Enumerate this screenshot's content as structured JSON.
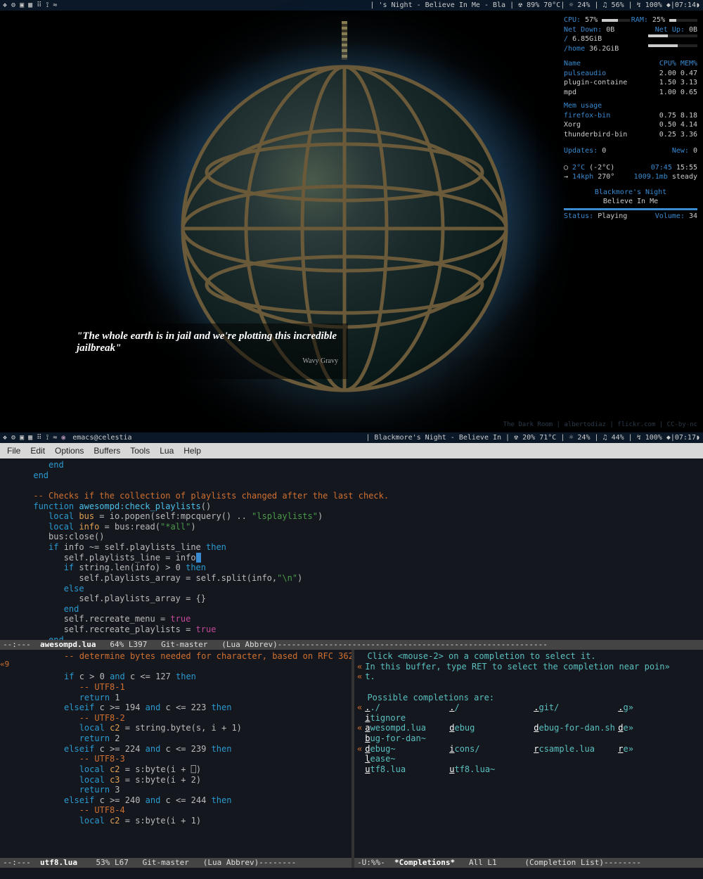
{
  "topbar1": {
    "left_icons": [
      "❖",
      "⚙",
      "▣",
      "▦",
      "⠿",
      "⟟",
      "≈"
    ],
    "right": "| 's Night - Believe In Me - Bla | ☢ 89% 70°C| ☼ 24% | ♫ 56% | ↯ 100% ◆|07:14◗"
  },
  "conky": {
    "cpu_l": "CPU:",
    "cpu_v": "57%",
    "ram_l": "RAM:",
    "ram_v": "25%",
    "ndl": "Net Down:",
    "ndv": "0B",
    "nul": "Net Up:",
    "nuv": "0B",
    "root": "/",
    "root_v": "6.85GiB",
    "home": "/home",
    "home_v": "36.2GiB",
    "hdr_name": "Name",
    "hdr_cpu": "CPU%",
    "hdr_mem": "MEM%",
    "p1": {
      "n": "pulseaudio",
      "c": "2.00",
      "m": "0.47"
    },
    "p2": {
      "n": "plugin-containe",
      "c": "1.50",
      "m": "3.13"
    },
    "p3": {
      "n": "mpd",
      "c": "1.00",
      "m": "0.65"
    },
    "mhdr": "Mem usage",
    "p4": {
      "n": "firefox-bin",
      "c": "0.75",
      "m": "8.18"
    },
    "p5": {
      "n": "Xorg",
      "c": "0.50",
      "m": "4.14"
    },
    "p6": {
      "n": "thunderbird-bin",
      "c": "0.25",
      "m": "3.36"
    },
    "upd_l": "Updates:",
    "upd_v": "0",
    "new_l": "New:",
    "new_v": "0",
    "temp": "2°C",
    "temp2": "(-2°C)",
    "time": "07:45",
    "secs": "15:55",
    "wind": "14kph",
    "dir": "270°",
    "press": "1009.1mb",
    "cond": "steady",
    "artist": "Blackmore's Night",
    "track": "Believe In Me",
    "st_l": "Status:",
    "st_v": "Playing",
    "vol_l": "Volume:",
    "vol_v": "34"
  },
  "quote": {
    "text": "\"The whole earth is in jail and we're plotting this incredible jailbreak\"",
    "attr": "Wavy Gravy"
  },
  "wstamp": "The Dark Room | albertodiaz | flickr.com | CC-by-nc",
  "topbar2": {
    "left_icons": [
      "❖",
      "⚙",
      "▣",
      "▦",
      "⠿",
      "⟟",
      "≈"
    ],
    "title": "emacs@celestia",
    "right": "| Blackmore's Night - Believe In | ☢ 20% 71°C | ☼ 24% | ♫ 44% | ↯ 100% ◆|07:17◗"
  },
  "menu": [
    "File",
    "Edit",
    "Options",
    "Buffers",
    "Tools",
    "Lua",
    "Help"
  ],
  "modeline_top": {
    "pre": "--:---  ",
    "name": "awesompd.lua",
    "rest": "   64% L397   Git-master   (Lua Abbrev)----------------------------------------------------------"
  },
  "modeline_bl": {
    "pre": "--:---  ",
    "name": "utf8.lua",
    "rest": "    53% L67   Git-master   (Lua Abbrev)--------"
  },
  "modeline_br": {
    "pre": "-U:%%-  ",
    "name": "*Completions*",
    "rest": "   All L1      (Completion List)--------"
  },
  "code_top": [
    {
      "i": 3,
      "t": [
        {
          "c": "kw",
          "s": "end"
        }
      ]
    },
    {
      "i": 2,
      "t": [
        {
          "c": "kw",
          "s": "end"
        }
      ]
    },
    {
      "i": 0,
      "t": []
    },
    {
      "i": 2,
      "t": [
        {
          "c": "cm",
          "s": "-- Checks if the collection of playlists changed after the last check."
        }
      ]
    },
    {
      "i": 2,
      "t": [
        {
          "c": "kw",
          "s": "function"
        },
        {
          "c": "txt",
          "s": " "
        },
        {
          "c": "fn",
          "s": "awesompd:check_playlists"
        },
        {
          "c": "txt",
          "s": "()"
        }
      ]
    },
    {
      "i": 3,
      "t": [
        {
          "c": "kw",
          "s": "local"
        },
        {
          "c": "txt",
          "s": " "
        },
        {
          "c": "lv",
          "s": "bus"
        },
        {
          "c": "txt",
          "s": " = io.popen(self:mpcquery() .. "
        },
        {
          "c": "str",
          "s": "\"lsplaylists\""
        },
        {
          "c": "txt",
          "s": ")"
        }
      ]
    },
    {
      "i": 3,
      "t": [
        {
          "c": "kw",
          "s": "local"
        },
        {
          "c": "txt",
          "s": " "
        },
        {
          "c": "lv",
          "s": "info"
        },
        {
          "c": "txt",
          "s": " = bus:read("
        },
        {
          "c": "str",
          "s": "\"*all\""
        },
        {
          "c": "txt",
          "s": ")"
        }
      ]
    },
    {
      "i": 3,
      "t": [
        {
          "c": "txt",
          "s": "bus:close()"
        }
      ]
    },
    {
      "i": 3,
      "t": [
        {
          "c": "kw",
          "s": "if"
        },
        {
          "c": "txt",
          "s": " info ~= self.playlists_line "
        },
        {
          "c": "kw",
          "s": "then"
        }
      ]
    },
    {
      "i": 4,
      "t": [
        {
          "c": "txt",
          "s": "self.playlists_line = info"
        },
        {
          "c": "cursor",
          "s": " "
        }
      ]
    },
    {
      "i": 4,
      "t": [
        {
          "c": "kw",
          "s": "if"
        },
        {
          "c": "txt",
          "s": " string.len(info) > 0 "
        },
        {
          "c": "kw",
          "s": "then"
        }
      ]
    },
    {
      "i": 5,
      "t": [
        {
          "c": "txt",
          "s": "self.playlists_array = self.split(info,"
        },
        {
          "c": "str",
          "s": "\"\\n\""
        },
        {
          "c": "txt",
          "s": ")"
        }
      ]
    },
    {
      "i": 4,
      "t": [
        {
          "c": "kw",
          "s": "else"
        }
      ]
    },
    {
      "i": 5,
      "t": [
        {
          "c": "txt",
          "s": "self.playlists_array = {}"
        }
      ]
    },
    {
      "i": 4,
      "t": [
        {
          "c": "kw",
          "s": "end"
        }
      ]
    },
    {
      "i": 4,
      "t": [
        {
          "c": "txt",
          "s": "self.recreate_menu = "
        },
        {
          "c": "lit",
          "s": "true"
        }
      ]
    },
    {
      "i": 4,
      "t": [
        {
          "c": "txt",
          "s": "self.recreate_playlists = "
        },
        {
          "c": "lit",
          "s": "true"
        }
      ]
    },
    {
      "i": 3,
      "t": [
        {
          "c": "kw",
          "s": "end"
        }
      ]
    }
  ],
  "gutter_bl": "«9",
  "code_bl": [
    {
      "i": 3,
      "t": [
        {
          "c": "cm",
          "s": "-- determine bytes needed for character, based on RFC 362"
        }
      ]
    },
    {
      "i": 0,
      "t": []
    },
    {
      "i": 3,
      "t": [
        {
          "c": "kw",
          "s": "if"
        },
        {
          "c": "txt",
          "s": " c > 0 "
        },
        {
          "c": "kw",
          "s": "and"
        },
        {
          "c": "txt",
          "s": " c <= 127 "
        },
        {
          "c": "kw",
          "s": "then"
        }
      ]
    },
    {
      "i": 4,
      "t": [
        {
          "c": "cm",
          "s": "-- UTF8-1"
        }
      ]
    },
    {
      "i": 4,
      "t": [
        {
          "c": "kw",
          "s": "return"
        },
        {
          "c": "txt",
          "s": " 1"
        }
      ]
    },
    {
      "i": 3,
      "t": [
        {
          "c": "kw",
          "s": "elseif"
        },
        {
          "c": "txt",
          "s": " c >= 194 "
        },
        {
          "c": "kw",
          "s": "and"
        },
        {
          "c": "txt",
          "s": " c <= 223 "
        },
        {
          "c": "kw",
          "s": "then"
        }
      ]
    },
    {
      "i": 4,
      "t": [
        {
          "c": "cm",
          "s": "-- UTF8-2"
        }
      ]
    },
    {
      "i": 4,
      "t": [
        {
          "c": "kw",
          "s": "local"
        },
        {
          "c": "txt",
          "s": " "
        },
        {
          "c": "lv",
          "s": "c2"
        },
        {
          "c": "txt",
          "s": " = string.byte(s, i + 1)"
        }
      ]
    },
    {
      "i": 4,
      "t": [
        {
          "c": "kw",
          "s": "return"
        },
        {
          "c": "txt",
          "s": " 2"
        }
      ]
    },
    {
      "i": 3,
      "t": [
        {
          "c": "kw",
          "s": "elseif"
        },
        {
          "c": "txt",
          "s": " c >= 224 "
        },
        {
          "c": "kw",
          "s": "and"
        },
        {
          "c": "txt",
          "s": " c <= 239 "
        },
        {
          "c": "kw",
          "s": "then"
        }
      ]
    },
    {
      "i": 4,
      "t": [
        {
          "c": "cm",
          "s": "-- UTF8-3"
        }
      ]
    },
    {
      "i": 4,
      "t": [
        {
          "c": "kw",
          "s": "local"
        },
        {
          "c": "txt",
          "s": " "
        },
        {
          "c": "lv",
          "s": "c2"
        },
        {
          "c": "txt",
          "s": " = s:byte(i + ⎕)"
        }
      ]
    },
    {
      "i": 4,
      "t": [
        {
          "c": "kw",
          "s": "local"
        },
        {
          "c": "txt",
          "s": " "
        },
        {
          "c": "lv",
          "s": "c3"
        },
        {
          "c": "txt",
          "s": " = s:byte(i + 2)"
        }
      ]
    },
    {
      "i": 4,
      "t": [
        {
          "c": "kw",
          "s": "return"
        },
        {
          "c": "txt",
          "s": " 3"
        }
      ]
    },
    {
      "i": 3,
      "t": [
        {
          "c": "kw",
          "s": "elseif"
        },
        {
          "c": "txt",
          "s": " c >= 240 "
        },
        {
          "c": "kw",
          "s": "and"
        },
        {
          "c": "txt",
          "s": " c <= 244 "
        },
        {
          "c": "kw",
          "s": "then"
        }
      ]
    },
    {
      "i": 4,
      "t": [
        {
          "c": "cm",
          "s": "-- UTF8-4"
        }
      ]
    },
    {
      "i": 4,
      "t": [
        {
          "c": "kw",
          "s": "local"
        },
        {
          "c": "txt",
          "s": " "
        },
        {
          "c": "lv",
          "s": "c2"
        },
        {
          "c": "txt",
          "s": " = s:byte(i + 1)"
        }
      ]
    }
  ],
  "comp_help": [
    "Click <mouse-2> on a completion to select it.",
    "In this buffer, type RET to select the completion near poin»",
    "t.",
    "",
    "Possible completions are:"
  ],
  "comp_rows": [
    [
      "../",
      "./",
      ".git/",
      ".g»"
    ],
    [
      "itignore",
      "",
      "",
      ""
    ],
    [
      "awesompd.lua",
      "debug",
      "debug-for-dan.sh",
      "de»"
    ],
    [
      "bug-for-dan~",
      "",
      "",
      ""
    ],
    [
      "debug~",
      "icons/",
      "rcsample.lua",
      "re»"
    ],
    [
      "lease~",
      "",
      "",
      ""
    ],
    [
      "utf8.lua",
      "utf8.lua~",
      "",
      ""
    ]
  ]
}
